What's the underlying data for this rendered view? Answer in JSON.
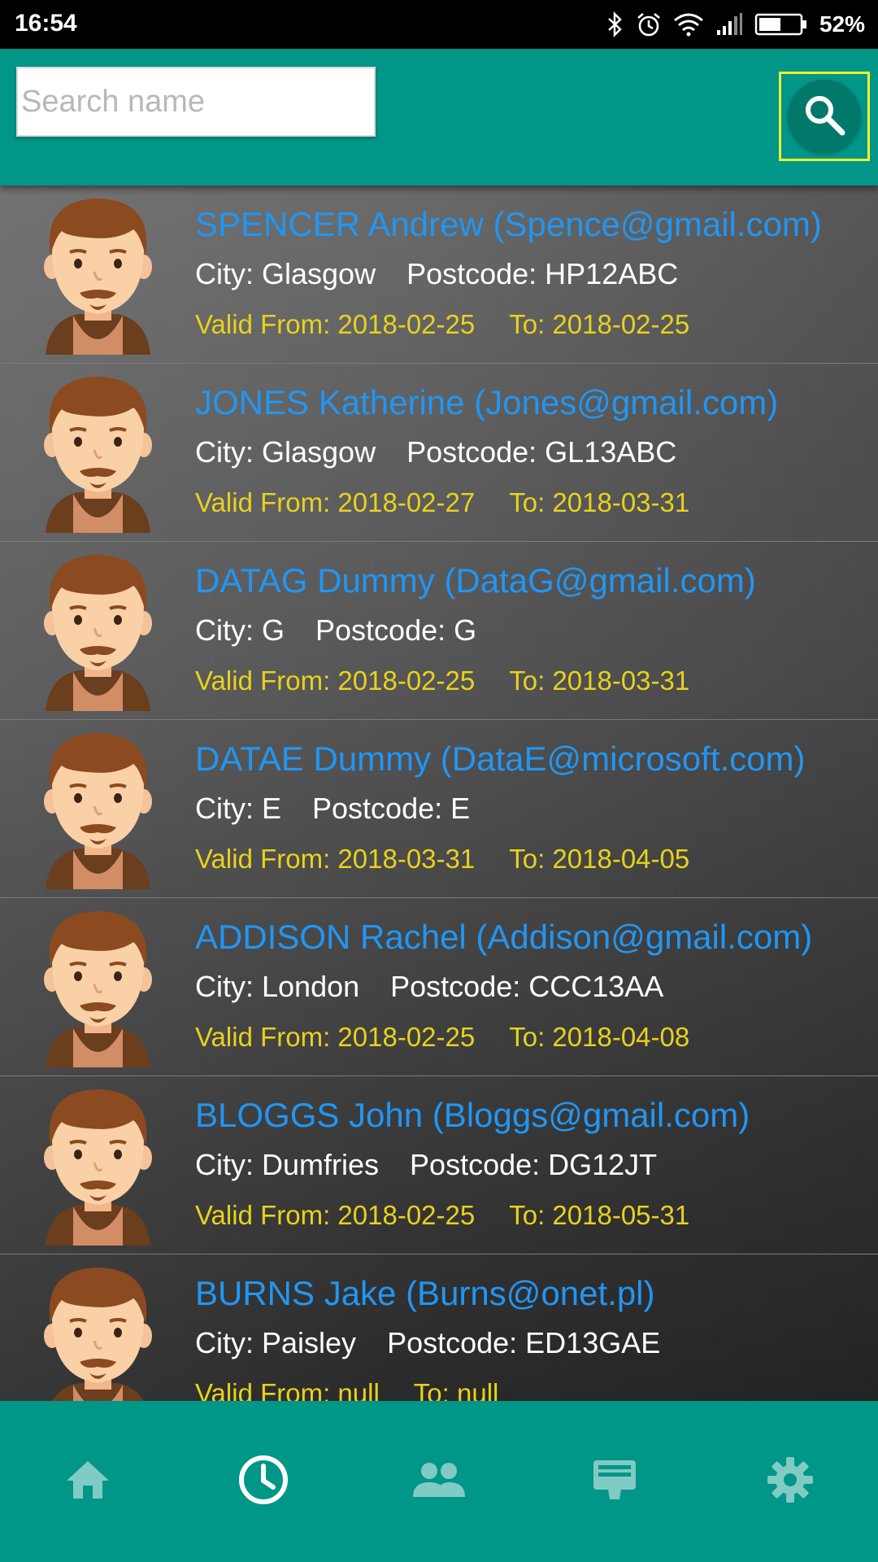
{
  "status_bar": {
    "time": "16:54",
    "battery": "52%"
  },
  "search": {
    "placeholder": "Search name",
    "value": ""
  },
  "rows": [
    {
      "name": "SPENCER Andrew (Spence@gmail.com)",
      "city": "City: Glasgow",
      "postcode": "Postcode: HP12ABC",
      "valid_from": "Valid From: 2018-02-25",
      "valid_to": "To: 2018-02-25"
    },
    {
      "name": "JONES Katherine (Jones@gmail.com)",
      "city": "City: Glasgow",
      "postcode": "Postcode: GL13ABC",
      "valid_from": "Valid From: 2018-02-27",
      "valid_to": "To: 2018-03-31"
    },
    {
      "name": "DATAG Dummy (DataG@gmail.com)",
      "city": "City: G",
      "postcode": "Postcode: G",
      "valid_from": "Valid From: 2018-02-25",
      "valid_to": "To: 2018-03-31"
    },
    {
      "name": "DATAE Dummy (DataE@microsoft.com)",
      "city": "City: E",
      "postcode": "Postcode: E",
      "valid_from": "Valid From: 2018-03-31",
      "valid_to": "To: 2018-04-05"
    },
    {
      "name": "ADDISON Rachel (Addison@gmail.com)",
      "city": "City: London",
      "postcode": "Postcode: CCC13AA",
      "valid_from": "Valid From: 2018-02-25",
      "valid_to": "To: 2018-04-08"
    },
    {
      "name": "BLOGGS John (Bloggs@gmail.com)",
      "city": "City: Dumfries",
      "postcode": "Postcode: DG12JT",
      "valid_from": "Valid From: 2018-02-25",
      "valid_to": "To: 2018-05-31"
    },
    {
      "name": "BURNS Jake (Burns@onet.pl)",
      "city": "City: Paisley",
      "postcode": "Postcode: ED13GAE",
      "valid_from": "Valid From: null",
      "valid_to": "To: null"
    }
  ],
  "bottom_nav": [
    {
      "icon": "home-icon",
      "active": false
    },
    {
      "icon": "clock-icon",
      "active": true
    },
    {
      "icon": "people-icon",
      "active": false
    },
    {
      "icon": "display-icon",
      "active": false
    },
    {
      "icon": "gear-icon",
      "active": false
    }
  ],
  "colors": {
    "primary": "#009688",
    "name_text": "#2196f3",
    "valid_text": "#e8d21c",
    "nav_icon": "#80cbc4",
    "nav_icon_active": "#ffffff"
  }
}
